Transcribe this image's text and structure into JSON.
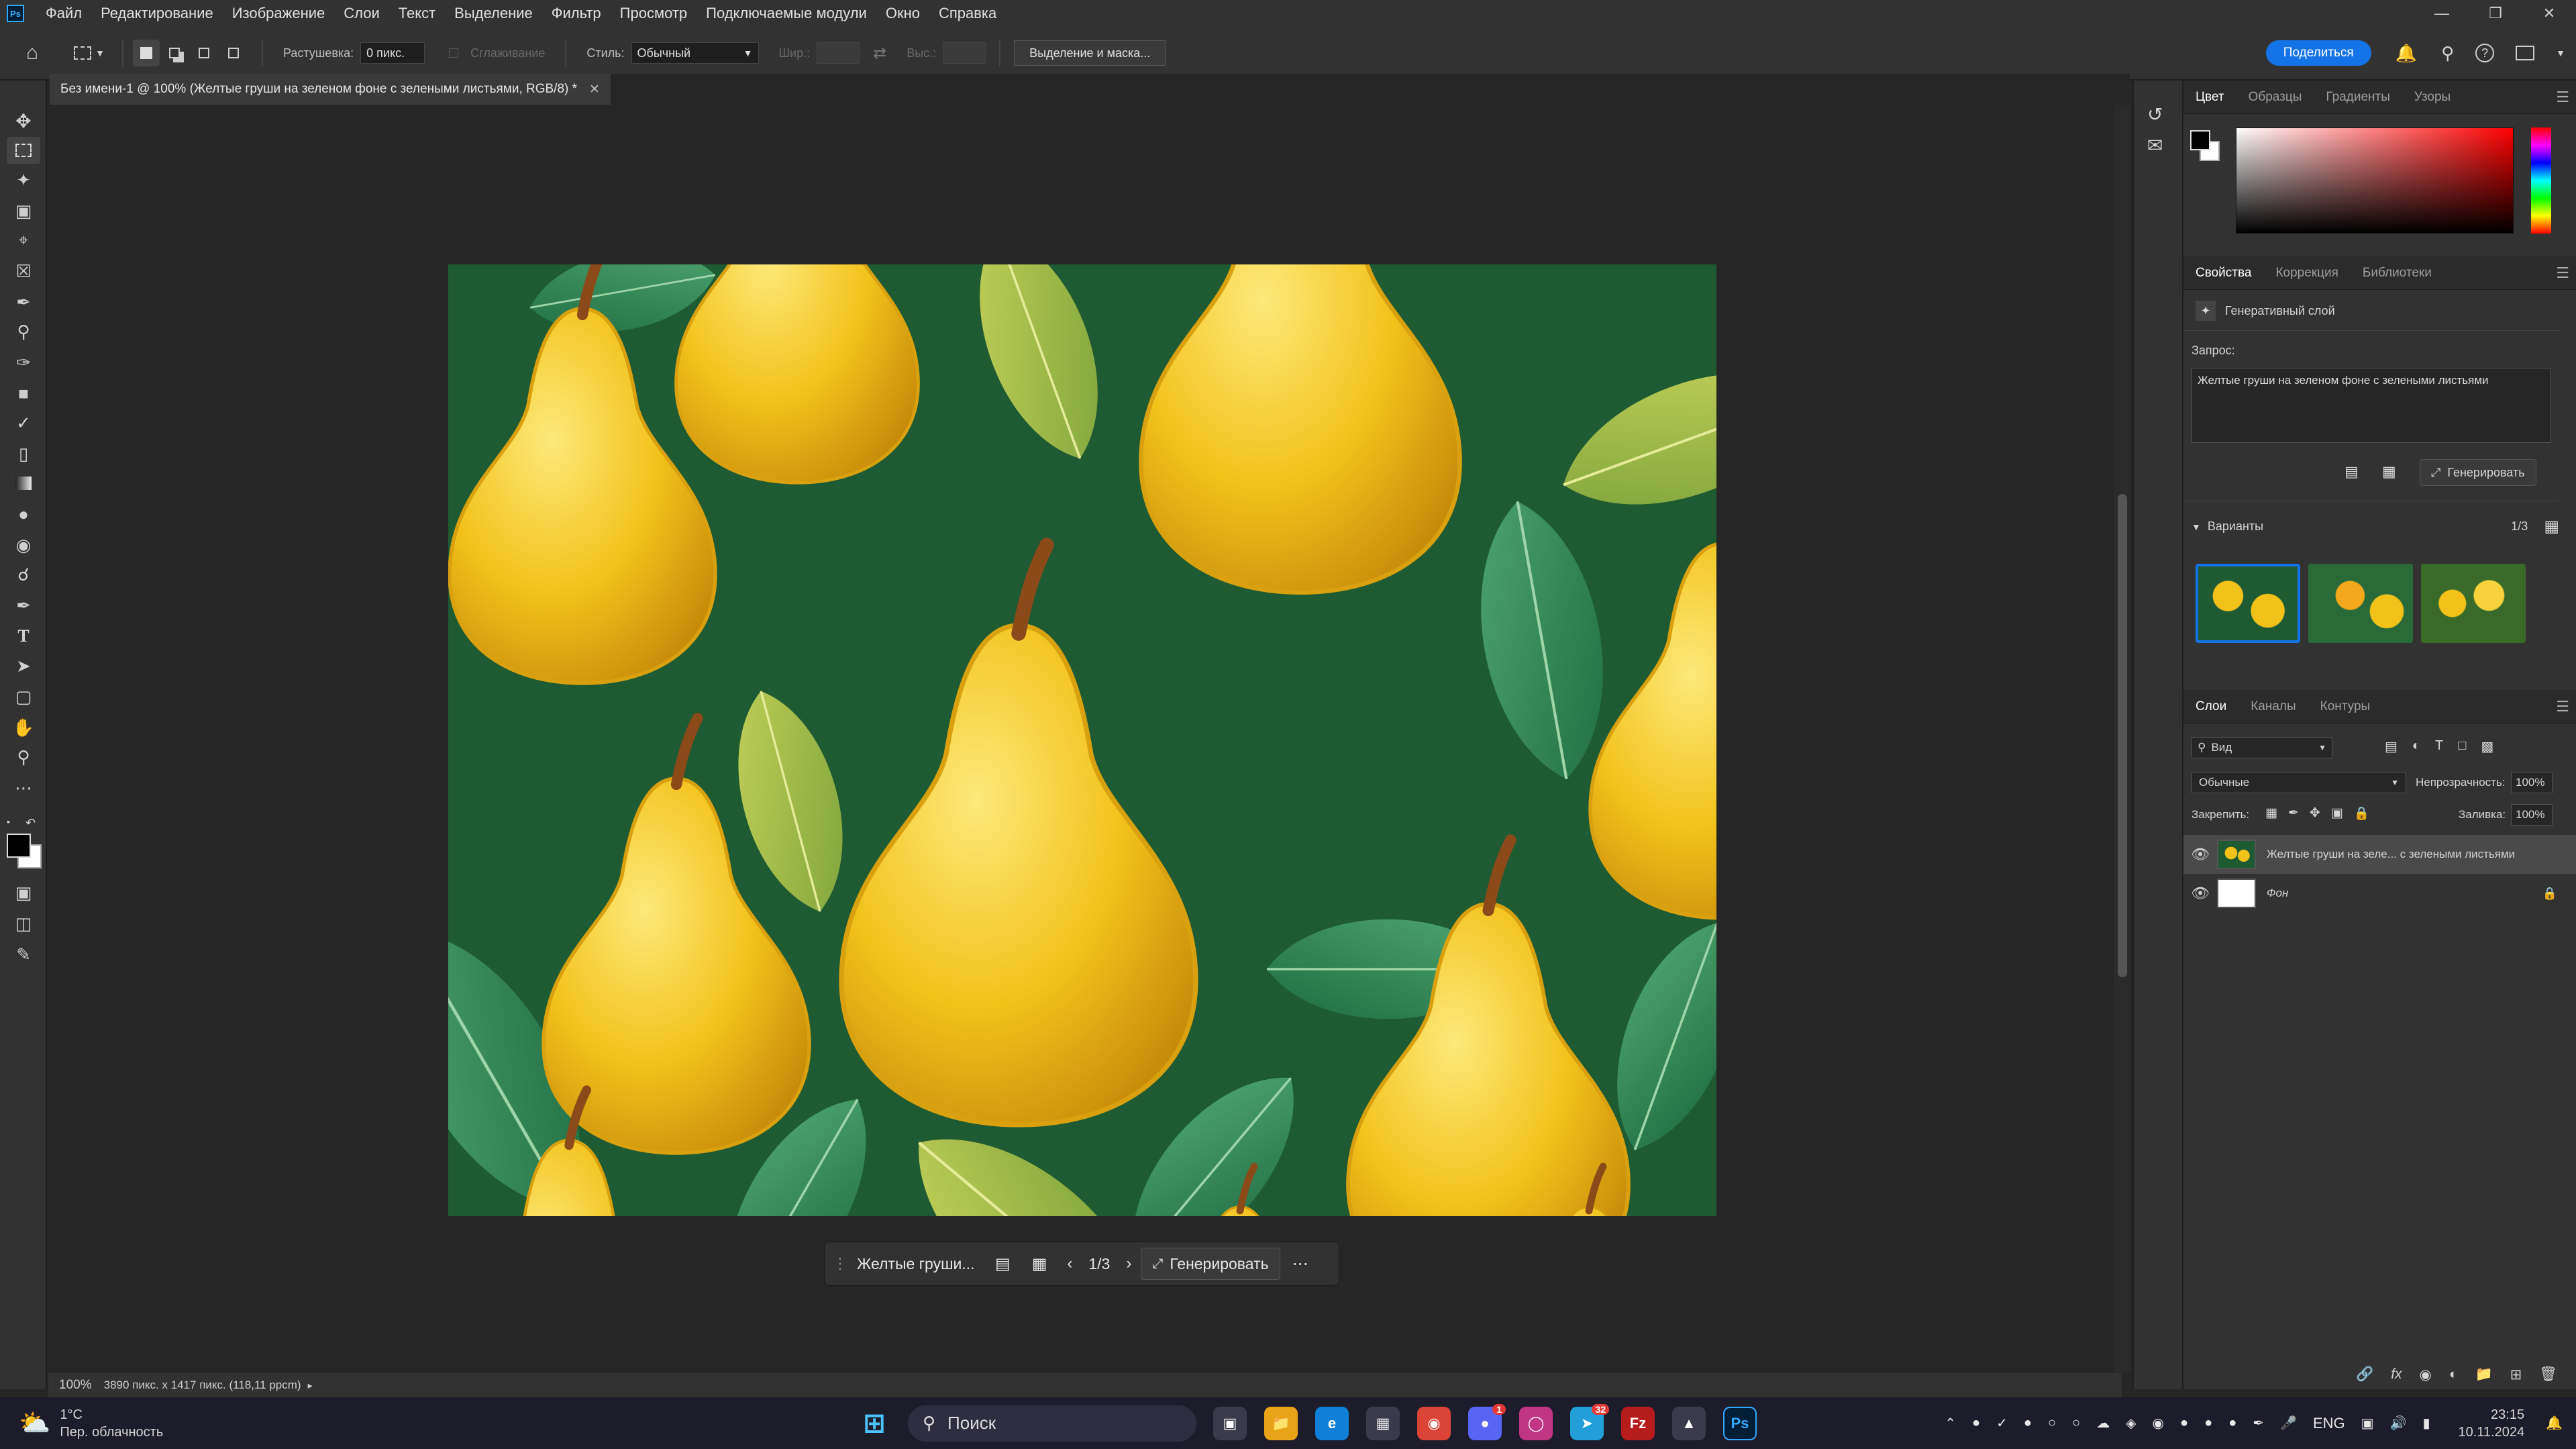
{
  "app": {
    "logo": "Ps"
  },
  "menu": [
    "Файл",
    "Редактирование",
    "Изображение",
    "Слои",
    "Текст",
    "Выделение",
    "Фильтр",
    "Просмотр",
    "Подключаемые модули",
    "Окно",
    "Справка"
  ],
  "options": {
    "feather_label": "Растушевка:",
    "feather_value": "0 пикс.",
    "smoothing": "Сглаживание",
    "style_label": "Стиль:",
    "style_value": "Обычный",
    "width_label": "Шир.:",
    "height_label": "Выс.:",
    "select_mask": "Выделение и маска...",
    "share": "Поделиться"
  },
  "document": {
    "tab_title": "Без имени-1 @ 100% (Желтые груши на зеленом фоне с зелеными листьями, RGB/8) *"
  },
  "context_bar": {
    "prompt": "Желтые груши...",
    "counter": "1/3",
    "generate": "Генерировать"
  },
  "status": {
    "zoom": "100%",
    "info": "3890 пикс. x 1417 пикс. (118,11 ppcm)"
  },
  "color_panel": {
    "tabs": [
      "Цвет",
      "Образцы",
      "Градиенты",
      "Узоры"
    ]
  },
  "properties_panel": {
    "tabs": [
      "Свойства",
      "Коррекция",
      "Библиотеки"
    ],
    "layer_type": "Генеративный слой",
    "prompt_label": "Запрос:",
    "prompt_text": "Желтые груши на зеленом фоне с зелеными листьями",
    "generate": "Генерировать",
    "variants_label": "Варианты",
    "variants_count": "1/3"
  },
  "layers_panel": {
    "tabs": [
      "Слои",
      "Каналы",
      "Контуры"
    ],
    "filter_label": "Вид",
    "blend_mode": "Обычные",
    "opacity_label": "Непрозрачность:",
    "opacity_value": "100%",
    "lock_label": "Закрепить:",
    "fill_label": "Заливка:",
    "fill_value": "100%",
    "layers": [
      {
        "name": "Желтые груши на зеле... с зелеными листьями"
      },
      {
        "name": "Фон"
      }
    ]
  },
  "taskbar": {
    "weather_temp": "1°C",
    "weather_desc": "Пер. облачность",
    "search": "Поиск",
    "lang": "ENG",
    "time": "23:15",
    "date": "10.11.2024",
    "badge_discord": "1",
    "badge_telegram": "32"
  },
  "colors": {
    "accent": "#1473e6",
    "pear": "#f2c21a",
    "bg_green": "#1e5a32"
  }
}
